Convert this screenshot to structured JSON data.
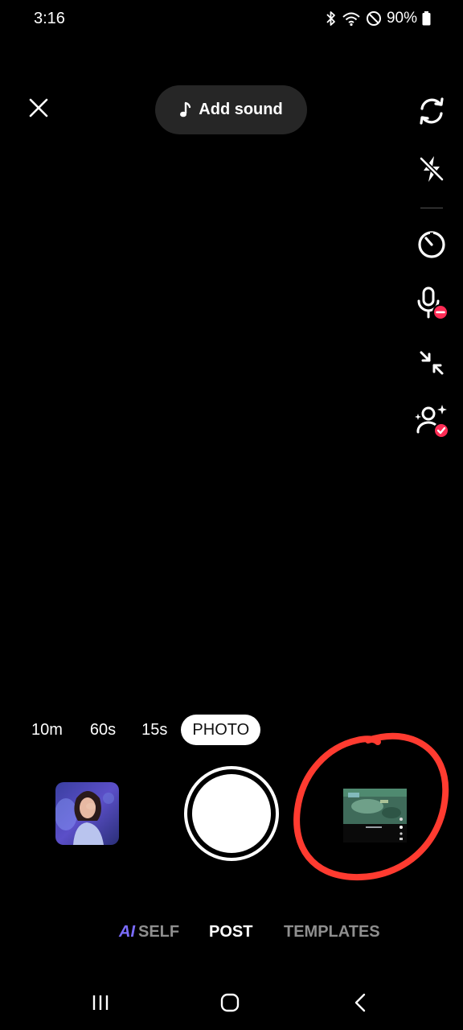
{
  "status_bar": {
    "time": "3:16",
    "battery": "90%",
    "icons": [
      "bluetooth-icon",
      "wifi-icon",
      "do-not-disturb-icon",
      "battery-icon"
    ]
  },
  "top": {
    "close_icon": "close-icon",
    "add_sound_label": "Add sound"
  },
  "right_rail": [
    {
      "name": "flip-camera-icon"
    },
    {
      "name": "flash-off-icon"
    },
    {
      "name": "timer-icon"
    },
    {
      "name": "mic-off-icon"
    },
    {
      "name": "collapse-icon"
    },
    {
      "name": "retouch-icon"
    }
  ],
  "modes": {
    "items": [
      "10m",
      "60s",
      "15s",
      "PHOTO"
    ],
    "selected": "PHOTO"
  },
  "capture": {
    "effects_icon": "effects-thumbnail",
    "upload_icon": "upload-gallery-thumbnail"
  },
  "tabs": {
    "ai_badge": "AI",
    "ai_label": "SELF",
    "post": "POST",
    "templates": "TEMPLATES",
    "selected": "POST"
  },
  "nav": [
    "recents-icon",
    "home-icon",
    "back-icon"
  ],
  "colors": {
    "background": "#000000",
    "pill": "#262626",
    "ai_accent": "#7b6cff",
    "badge_red": "#fe2c55",
    "annotation_red": "#ff3b30"
  }
}
